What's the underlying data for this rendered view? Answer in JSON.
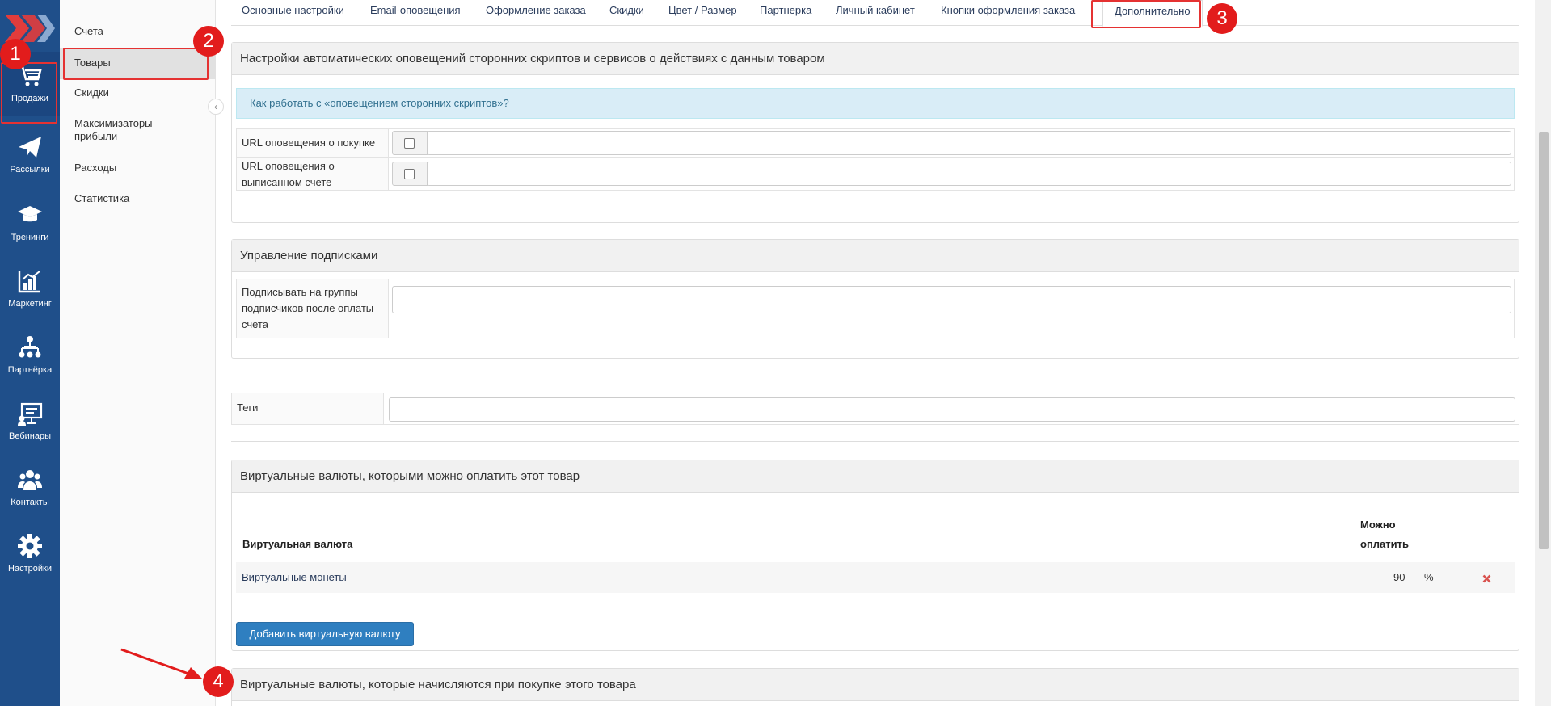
{
  "colors": {
    "rail_bg": "#1f4f8a",
    "marker": "#e21c1c",
    "info_bg": "#d9edf7",
    "primary": "#2f7fc0"
  },
  "rail": {
    "items": [
      {
        "label": "Продажи",
        "icon": "cart-icon"
      },
      {
        "label": "Рассылки",
        "icon": "paper-plane-icon"
      },
      {
        "label": "Тренинги",
        "icon": "graduation-cap-icon"
      },
      {
        "label": "Маркетинг",
        "icon": "chart-icon"
      },
      {
        "label": "Партнёрка",
        "icon": "network-icon"
      },
      {
        "label": "Вебинары",
        "icon": "presentation-icon"
      },
      {
        "label": "Контакты",
        "icon": "users-icon"
      },
      {
        "label": "Настройки",
        "icon": "gear-icon"
      }
    ]
  },
  "subnav": {
    "items": [
      {
        "label": "Счета"
      },
      {
        "label": "Товары"
      },
      {
        "label": "Скидки"
      },
      {
        "label": "Максимизаторы прибыли"
      },
      {
        "label": "Расходы"
      },
      {
        "label": "Статистика"
      }
    ],
    "collapse_glyph": "‹"
  },
  "tabs": [
    {
      "label": "Основные настройки"
    },
    {
      "label": "Email-оповещения"
    },
    {
      "label": "Оформление заказа"
    },
    {
      "label": "Скидки"
    },
    {
      "label": "Цвет / Размер"
    },
    {
      "label": "Партнерка"
    },
    {
      "label": "Личный кабинет"
    },
    {
      "label": "Кнопки оформления заказа"
    },
    {
      "label": "Дополнительно"
    }
  ],
  "annotations": {
    "b1": "1",
    "b2": "2",
    "b3": "3",
    "b4": "4"
  },
  "notifications": {
    "title": "Настройки автоматических оповещений сторонних скриптов и сервисов о действиях с данным товаром",
    "info": "Как работать с «оповещением сторонних скриптов»?",
    "purchase_url_label": "URL оповещения о покупке",
    "invoice_url_label": "URL оповещения о выписанном счете",
    "purchase_url_value": "",
    "invoice_url_value": ""
  },
  "subscriptions": {
    "title": "Управление подписками",
    "groups_label": "Подписывать на группы подписчиков после оплаты счета",
    "groups_value": ""
  },
  "tags": {
    "label": "Теги",
    "value": ""
  },
  "currencies_pay": {
    "title": "Виртуальные валюты, которыми можно оплатить этот товар",
    "col_currency": "Виртуальная валюта",
    "col_can_pay": "Можно оплатить",
    "rows": [
      {
        "name": "Виртуальные монеты",
        "value": "90",
        "unit": "%"
      }
    ],
    "add_button": "Добавить виртуальную валюту"
  },
  "currencies_earn": {
    "title": "Виртуальные валюты, которые начисляются при покупке этого товара"
  }
}
